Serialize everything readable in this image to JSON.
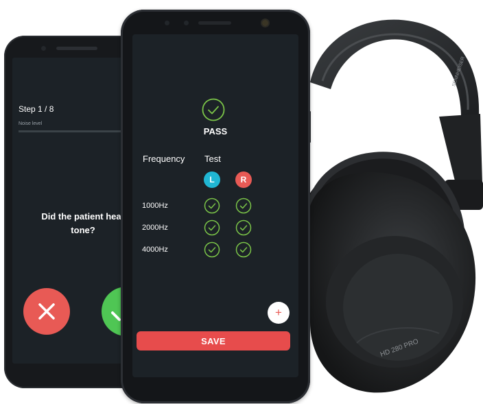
{
  "back_screen": {
    "step": "Step 1 / 8",
    "noise_label": "Noise level",
    "question": "Did the patient hear tone?"
  },
  "front_screen": {
    "status": "PASS",
    "headers": {
      "frequency": "Frequency",
      "test": "Test"
    },
    "ears": {
      "left": "L",
      "right": "R"
    },
    "rows": [
      {
        "frequency": "1000Hz",
        "left_pass": true,
        "right_pass": true
      },
      {
        "frequency": "2000Hz",
        "left_pass": true,
        "right_pass": true
      },
      {
        "frequency": "4000Hz",
        "left_pass": true,
        "right_pass": true
      }
    ],
    "add_symbol": "+",
    "save_label": "SAVE"
  },
  "headphones": {
    "brand_text": "SENNHEISER",
    "model_text": "HD 280 PRO"
  },
  "colors": {
    "screen_bg": "#1c2227",
    "pass_green": "#7bc548",
    "left_badge": "#20b6d3",
    "right_badge": "#e85a55",
    "save_red": "#e74c4c",
    "yes_green": "#4fc654"
  },
  "icons": {
    "pass": "check-circle-icon",
    "test_result": "check-circle-icon",
    "no": "close-icon",
    "add": "plus-icon"
  }
}
